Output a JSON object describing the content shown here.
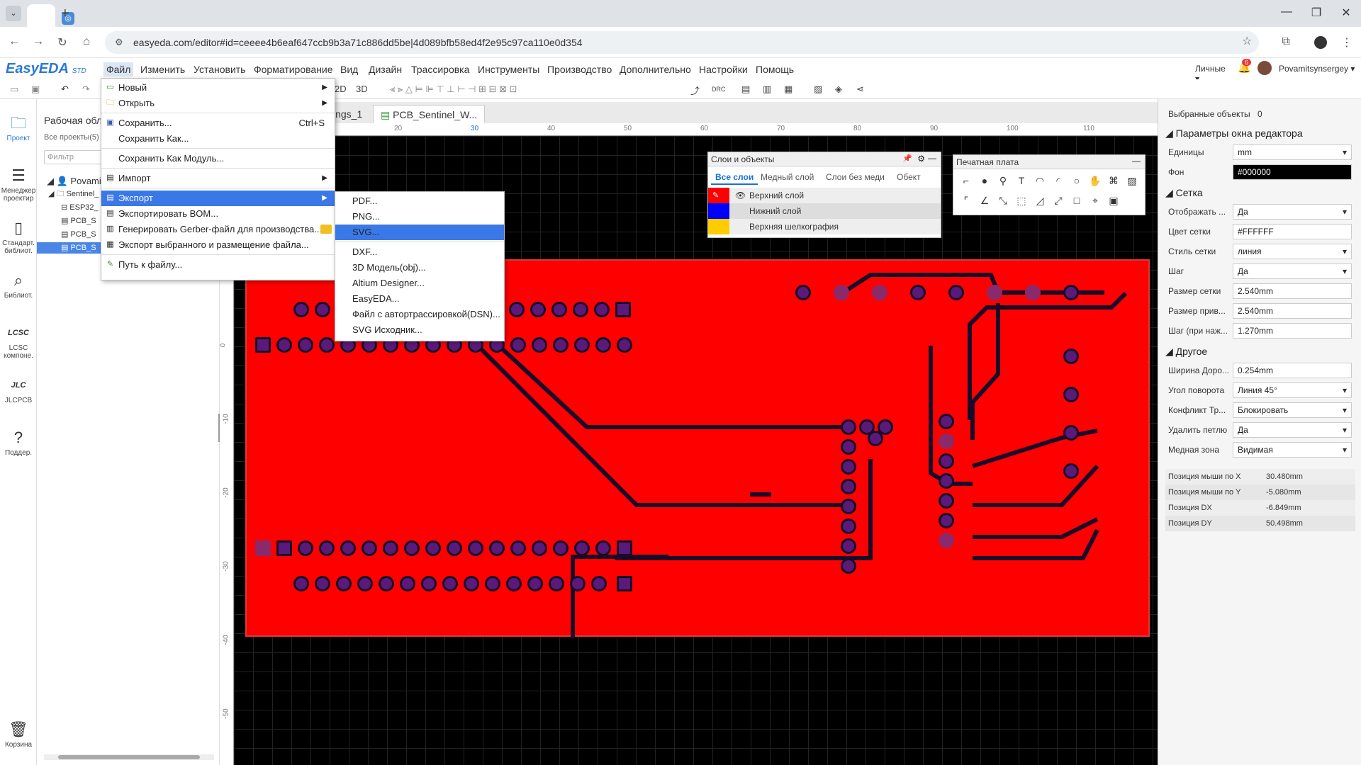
{
  "browser": {
    "url": "easyeda.com/editor#id=ceeee4b6eaf647ccb9b3a71c886dd5be|4d089bfb58ed4f2e95c97ca110e0d354",
    "new_tab": "+"
  },
  "app": {
    "logo": "EasyEDA",
    "logo_suffix": "STD",
    "menu": [
      "Файл",
      "Изменить",
      "Установить",
      "Форматирование",
      "Вид",
      "Дизайн",
      "Трассировка",
      "Инструменты",
      "Производство",
      "Дополнительно",
      "Настройки",
      "Помощь"
    ],
    "user_mode": "Личные ▾",
    "notif_count": "6",
    "username": "Povamitsynsergey ▾",
    "toolbar_2d": "2D",
    "toolbar_3d": "3D",
    "toolbar_drc": "DRC"
  },
  "leftnav": [
    {
      "label": "Проект",
      "icon": "folder-icon"
    },
    {
      "label": "Менеджер проектир",
      "icon": "list-icon"
    },
    {
      "label": "Стандарт. библиот.",
      "icon": "chip-icon"
    },
    {
      "label": "Библиот.",
      "icon": "search-icon"
    },
    {
      "label": "LCSC компоне.",
      "icon": "lcsc-icon"
    },
    {
      "label": "JLCPCB",
      "icon": "jlc-icon"
    },
    {
      "label": "Поддер.",
      "icon": "help-icon"
    },
    {
      "label": "Корзина",
      "icon": "trash-icon"
    }
  ],
  "project_panel": {
    "title": "Рабочая обла",
    "all_projects": "Все проекты(5)",
    "filter_placeholder": "Фильтр",
    "tree": [
      "Povamits",
      "Sentinel_",
      "ESP32_",
      "PCB_S",
      "PCB_S",
      "PCB_S"
    ]
  },
  "doc_tabs": [
    "ings_1",
    "PCB_Sentinel_W..."
  ],
  "ruler_top": [
    "20",
    "30",
    "40",
    "50",
    "60",
    "70",
    "80",
    "90",
    "100",
    "110"
  ],
  "ruler_left": [
    "0",
    "-10",
    "-20",
    "-30",
    "-40",
    "-50",
    "-60"
  ],
  "file_menu": {
    "new": "Новый",
    "open": "Открыть",
    "save": "Сохранить...",
    "save_shortcut": "Ctrl+S",
    "save_as": "Сохранить Как...",
    "save_as_module": "Сохранить Как Модуль...",
    "import": "Импорт",
    "export": "Экспорт",
    "export_bom": "Экспортировать BOM...",
    "gerber": "Генерировать Gerber-файл для производства...",
    "export_selected": "Экспорт выбранного и размещение файла...",
    "file_path": "Путь к файлу..."
  },
  "export_menu": [
    "PDF...",
    "PNG...",
    "SVG...",
    "DXF...",
    "3D Модель(obj)...",
    "Altium Designer...",
    "EasyEDA...",
    "Файл с автортрассировкой(DSN)...",
    "SVG Исходник..."
  ],
  "layers_panel": {
    "title": "Слои и объекты",
    "tabs": [
      "Все слои",
      "Медный слой",
      "Слои без меди",
      "Обект"
    ],
    "layers": [
      {
        "name": "Верхний слой",
        "color": "#ff0000"
      },
      {
        "name": "Нижний слой",
        "color": "#0000ff"
      },
      {
        "name": "Верхняя шелкография",
        "color": "#ffcc00"
      }
    ]
  },
  "pcb_panel": {
    "title": "Печатная плата"
  },
  "right_panel": {
    "selected_label": "Выбранные объекты",
    "selected_count": "0",
    "editor_params": "Параметры окна редактора",
    "units_label": "Единицы",
    "units": "mm",
    "bg_label": "Фон",
    "bg": "#000000",
    "grid_section": "Сетка",
    "show_label": "Отображать ...",
    "show": "Да",
    "grid_color_label": "Цвет сетки",
    "grid_color": "#FFFFFF",
    "grid_style_label": "Стиль сетки",
    "grid_style": "линия",
    "step_label": "Шаг",
    "step": "Да",
    "grid_size_label": "Размер сетки",
    "grid_size": "2.540mm",
    "snap_size_label": "Размер прив...",
    "snap_size": "2.540mm",
    "alt_step_label": "Шаг (при наж...",
    "alt_step": "1.270mm",
    "other_section": "Другое",
    "track_width_label": "Ширина Доро...",
    "track_width": "0.254mm",
    "angle_label": "Угол поворота",
    "angle": "Линия 45°",
    "conflict_label": "Конфликт Тр...",
    "conflict": "Блокировать",
    "remove_loop_label": "Удалить петлю",
    "remove_loop": "Да",
    "copper_zone_label": "Медная зона",
    "copper_zone": "Видимая",
    "mouse_x_label": "Позиция мыши по X",
    "mouse_x": "30.480mm",
    "mouse_y_label": "Позиция мыши по Y",
    "mouse_y": "-5.080mm",
    "dx_label": "Позиция DX",
    "dx": "-6.849mm",
    "dy_label": "Позиция DY",
    "dy": "50.498mm"
  }
}
